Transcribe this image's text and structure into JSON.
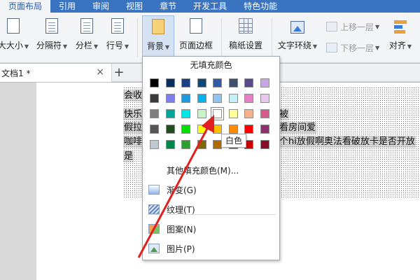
{
  "menu_tabs": [
    "页面布局",
    "引用",
    "审阅",
    "视图",
    "章节",
    "开发工具",
    "特色功能"
  ],
  "ribbon": {
    "paper_size": "大大小",
    "separator": "分隔符",
    "columns": "分栏",
    "line_number": "行号",
    "background": "背景",
    "page_border": "页面边框",
    "manuscript": "稿纸设置",
    "text_wrap": "文字环绕",
    "bring_forward": "上移一层",
    "send_backward": "下移一层",
    "align": "对齐"
  },
  "doc_tab": {
    "name": "文档1 *",
    "close": "×",
    "add": "+"
  },
  "document_lines": [
    "会收",
    "快乐",
    "假拉",
    "咖啡",
    "是"
  ],
  "document_fragments": {
    "line2_end": "被",
    "line3_end": "看房间爱",
    "line4_end": "个hi放假啊奥法看破放卡是否开放"
  },
  "dropdown": {
    "title": "无填充颜色",
    "more_colors": "其他填充颜色(M)...",
    "gradient": "渐变(G)",
    "texture": "纹理(T)",
    "pattern": "图案(N)",
    "picture": "图片(P)"
  },
  "tooltip": "白色",
  "palette": [
    [
      "#000000",
      "#0a2f5f",
      "#1c3f85",
      "#0b4a7a",
      "#2f5ea8",
      "#3f4f6f",
      "#5a4a8a",
      "#c9a5e8"
    ],
    [
      "#3a3a3a",
      "#7e7eef",
      "#1e9ae0",
      "#00b4f0",
      "#8fc4f5",
      "#c6f0f7",
      "#e67fc6",
      "#e8c6f0"
    ],
    [
      "#7f7f7f",
      "#00a59a",
      "#00e5e5",
      "#c8f5c8",
      "#ffffff",
      "#ffff99",
      "#f5b08a",
      "#d85a8a"
    ],
    [
      "#555555",
      "#1f4f1f",
      "#00e000",
      "#ffff00",
      "#ffc000",
      "#ff8c00",
      "#ff0000",
      "#8f2f6f"
    ],
    [
      "#c0c8d4",
      "#00884a",
      "#2fa02f",
      "#7a6a00",
      "#b06a00",
      "#ff4500",
      "#d00000",
      "#8a0a2a"
    ]
  ],
  "selected_swatch": "白色"
}
